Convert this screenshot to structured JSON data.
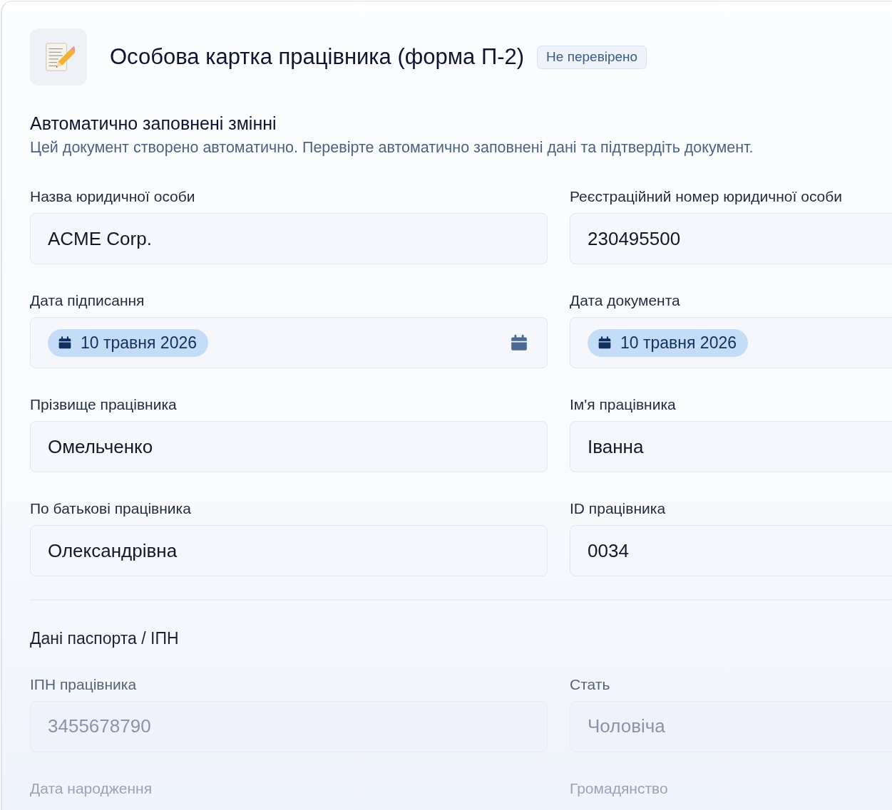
{
  "header": {
    "title": "Особова картка працівника (форма П-2)",
    "badge": "Не перевірено"
  },
  "intro": {
    "heading": "Автоматично заповнені змінні",
    "description": "Цей документ створено автоматично. Перевірте автоматично заповнені дані та підтвердіть документ."
  },
  "fields": [
    {
      "kind": "text",
      "label": "Назва юридичної особи",
      "value": "ACME Corp."
    },
    {
      "kind": "text",
      "label": "Реєстраційний номер юридичної особи",
      "value": "230495500"
    },
    {
      "kind": "date",
      "label": "Дата підписання",
      "value": "10 травня 2026",
      "picker_icon": true
    },
    {
      "kind": "date",
      "label": "Дата документа",
      "value": "10 травня 2026"
    },
    {
      "kind": "text",
      "label": "Прізвище працівника",
      "value": "Омельченко"
    },
    {
      "kind": "text",
      "label": "Ім'я працівника",
      "value": "Іванна"
    },
    {
      "kind": "text",
      "label": "По батькові працівника",
      "value": "Олександрівна"
    },
    {
      "kind": "text",
      "label": "ID працівника",
      "value": "0034"
    }
  ],
  "passport_section": {
    "heading": "Дані паспорта / ІПН",
    "fields": [
      {
        "kind": "text",
        "label": "ІПН працівника",
        "value": "3455678790",
        "disabled": true
      },
      {
        "kind": "text",
        "label": "Стать",
        "value": "Чоловіча",
        "disabled": true
      },
      {
        "kind": "label_only",
        "label": "Дата народження",
        "disabled": true
      },
      {
        "kind": "label_only",
        "label": "Громадянство",
        "disabled": true
      }
    ]
  }
}
